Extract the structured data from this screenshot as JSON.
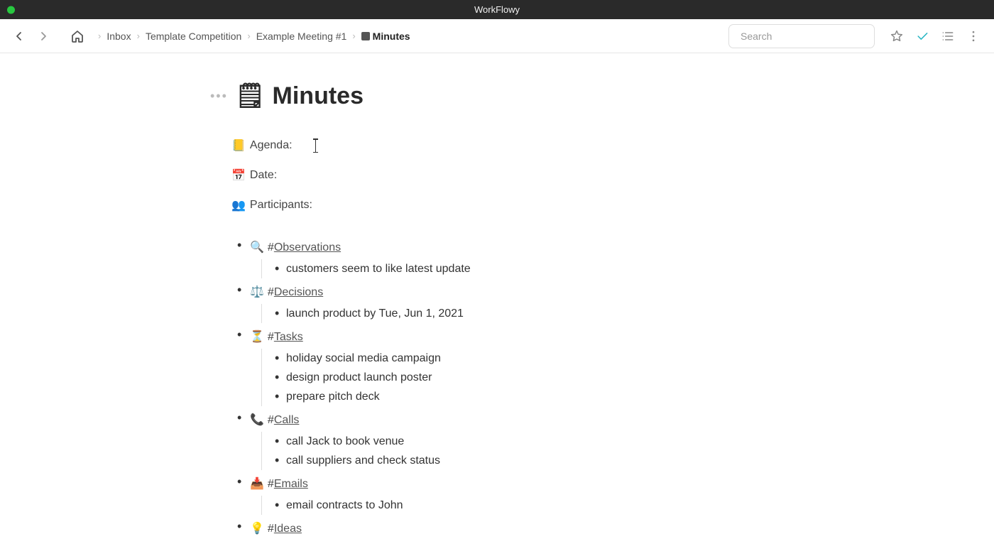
{
  "app": {
    "title": "WorkFlowy"
  },
  "toolbar": {
    "search_placeholder": "Search"
  },
  "breadcrumbs": [
    {
      "label": "Inbox"
    },
    {
      "label": "Template Competition"
    },
    {
      "label": "Example Meeting #1"
    },
    {
      "label": "Minutes",
      "current": true,
      "icon": "panel"
    }
  ],
  "page": {
    "title_emoji": "🗒",
    "title": "Minutes",
    "meta": [
      {
        "emoji": "📒",
        "label": "Agenda:",
        "cursor": true
      },
      {
        "emoji": "📅",
        "label": "Date:"
      },
      {
        "emoji": "👥",
        "label": "Participants:"
      }
    ],
    "categories": [
      {
        "emoji": "🔍",
        "tag": "Observations",
        "items": [
          "customers seem to like latest update"
        ]
      },
      {
        "emoji": "⚖️",
        "tag": "Decisions",
        "items": [
          "launch product by Tue, Jun 1, 2021"
        ]
      },
      {
        "emoji": "⏳",
        "tag": "Tasks",
        "items": [
          "holiday social media campaign",
          "design product launch poster",
          "prepare pitch deck"
        ]
      },
      {
        "emoji": "📞",
        "tag": "Calls",
        "items": [
          "call Jack to book venue",
          "call suppliers and check status"
        ]
      },
      {
        "emoji": "📥",
        "tag": "Emails",
        "items": [
          "email contracts to John"
        ]
      },
      {
        "emoji": "💡",
        "tag": "Ideas",
        "items": []
      }
    ]
  }
}
